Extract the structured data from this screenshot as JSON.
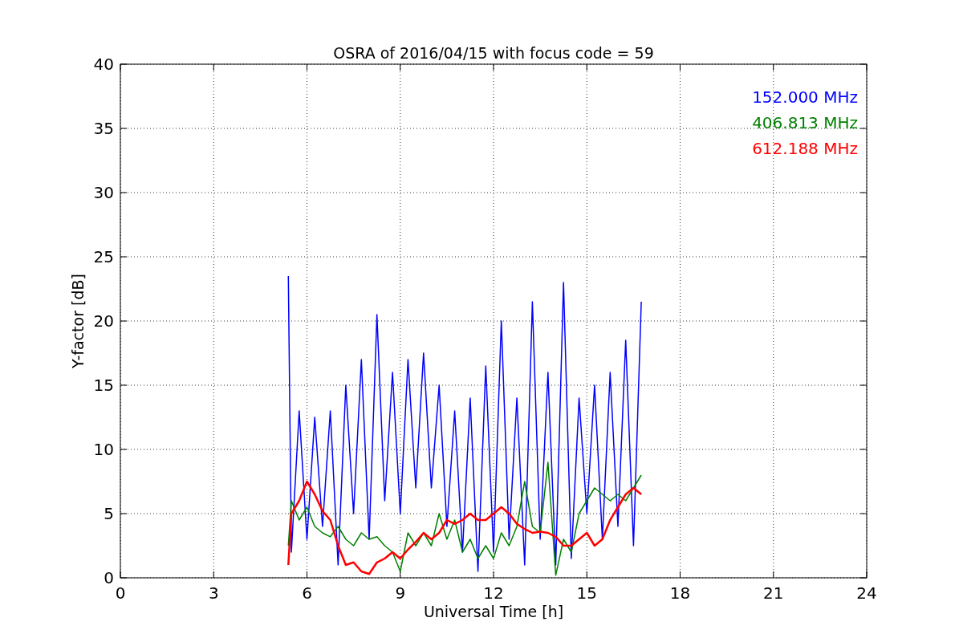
{
  "chart_data": {
    "type": "line",
    "grid": true,
    "title": "OSRA of 2016/04/15 with focus code = 59",
    "xlabel": "Universal Time [h]",
    "ylabel": "Y-factor [dB]",
    "xlim": [
      0,
      24
    ],
    "ylim": [
      0,
      40
    ],
    "xticks": [
      0,
      3,
      6,
      9,
      12,
      15,
      18,
      21,
      24
    ],
    "yticks": [
      0,
      5,
      10,
      15,
      20,
      25,
      30,
      35,
      40
    ],
    "x": [
      5.4,
      5.5,
      5.75,
      6,
      6.25,
      6.5,
      6.75,
      7,
      7.25,
      7.5,
      7.75,
      8,
      8.25,
      8.5,
      8.75,
      9,
      9.25,
      9.5,
      9.75,
      10,
      10.25,
      10.5,
      10.75,
      11,
      11.25,
      11.5,
      11.75,
      12,
      12.25,
      12.5,
      12.75,
      13,
      13.25,
      13.5,
      13.75,
      14,
      14.25,
      14.5,
      14.75,
      15,
      15.25,
      15.5,
      15.75,
      16,
      16.25,
      16.5,
      16.75
    ],
    "series": [
      {
        "name": "152.000 MHz",
        "color": "#0000ff",
        "values": [
          23.5,
          2,
          13,
          3,
          12.5,
          4,
          13,
          1,
          15,
          5,
          17,
          3,
          20.5,
          6,
          16,
          5,
          17,
          7,
          17.5,
          7,
          15,
          4,
          13,
          2,
          14,
          0.5,
          16.5,
          2,
          20,
          3,
          14,
          1,
          21.5,
          3,
          16,
          1,
          23,
          1.5,
          14,
          5,
          15,
          3,
          16,
          4,
          18.5,
          2.5,
          21.5
        ]
      },
      {
        "name": "406.813 MHz",
        "color": "#008000",
        "values": [
          2.5,
          6,
          4.5,
          5.5,
          4,
          3.5,
          3.2,
          4,
          3,
          2.5,
          3.5,
          3,
          3.2,
          2.5,
          2,
          0.5,
          3.5,
          2.5,
          3.5,
          2.5,
          5,
          3,
          4.5,
          2,
          3,
          1.5,
          2.5,
          1.5,
          3.5,
          2.5,
          4,
          7.5,
          4,
          3.5,
          9,
          0.2,
          3,
          2,
          5,
          6,
          7,
          6.5,
          6,
          6.5,
          6,
          7,
          8
        ]
      },
      {
        "name": "612.188 MHz",
        "color": "#ff0000",
        "values": [
          1,
          5,
          6,
          7.5,
          6.5,
          5.2,
          4.5,
          2.5,
          1,
          1.2,
          0.5,
          0.3,
          1.2,
          1.5,
          2,
          1.5,
          2.2,
          2.8,
          3.5,
          3,
          3.5,
          4.5,
          4.2,
          4.5,
          5,
          4.5,
          4.5,
          5,
          5.5,
          5,
          4.2,
          3.8,
          3.5,
          3.6,
          3.5,
          3.2,
          2.5,
          2.5,
          3,
          3.5,
          2.5,
          3,
          4.5,
          5.5,
          6.5,
          7,
          6.5
        ]
      }
    ]
  }
}
